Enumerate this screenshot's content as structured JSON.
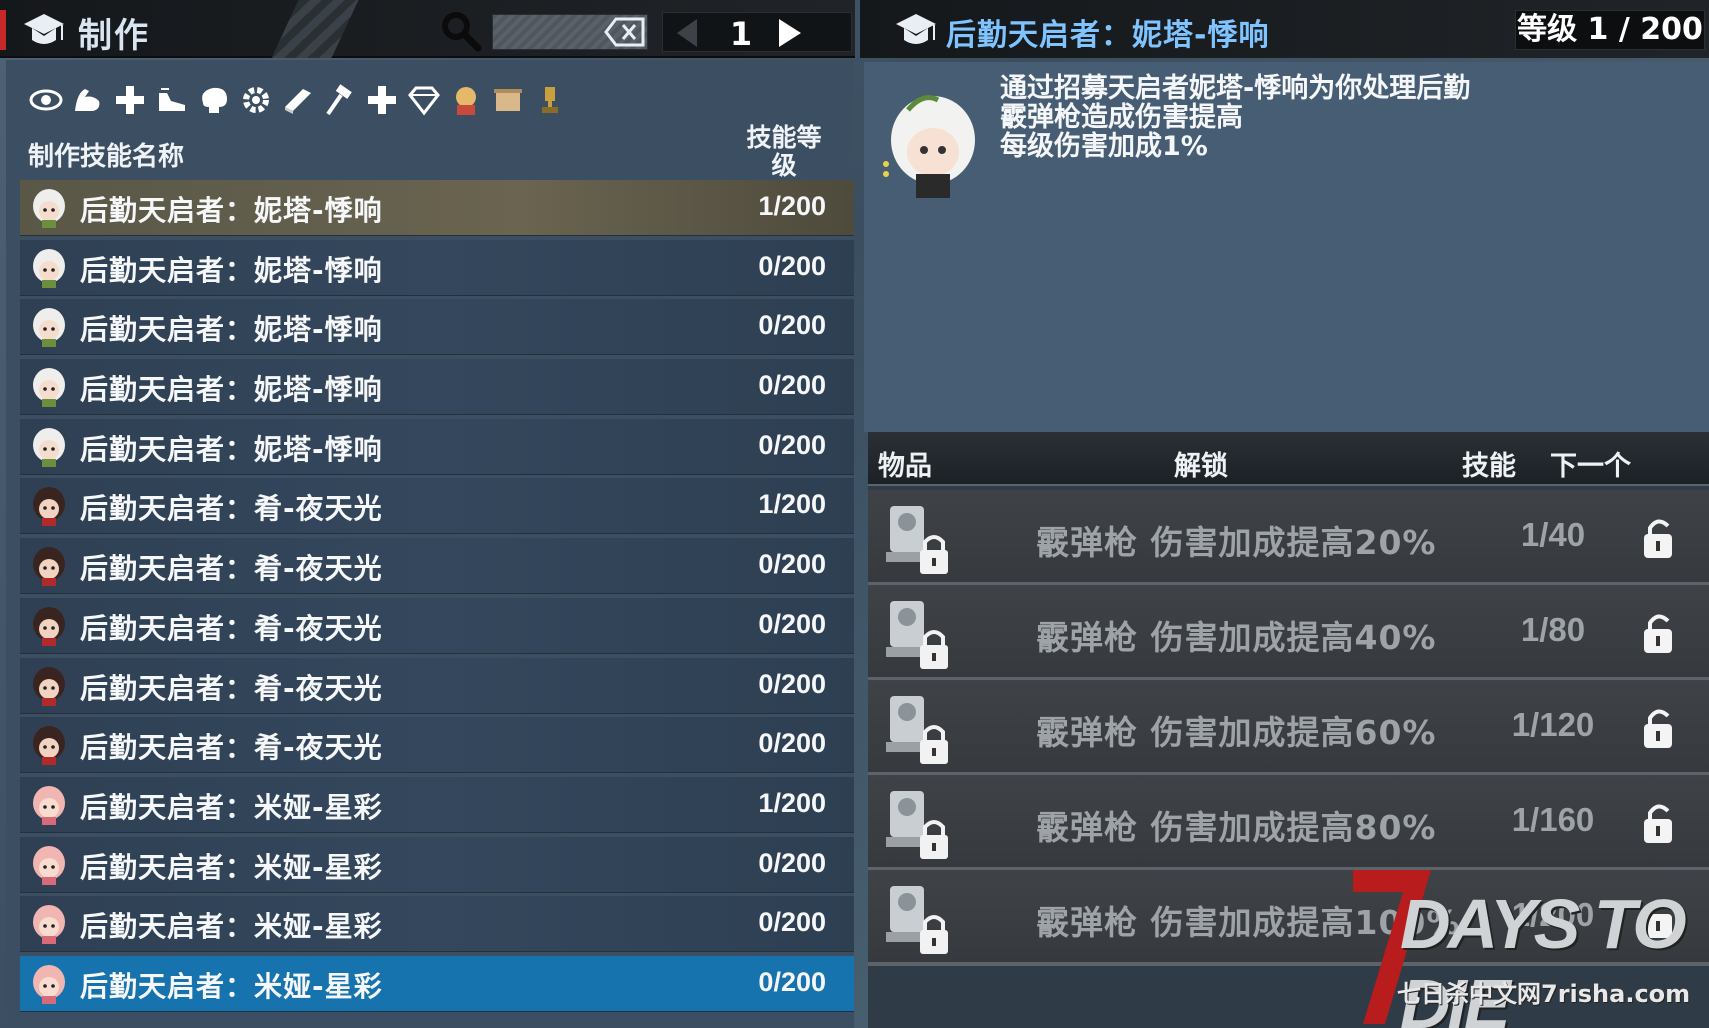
{
  "left": {
    "title": "制作",
    "page": "1",
    "col_name": "制作技能名称",
    "col_level": "技能等级",
    "filters": [
      "eye-icon",
      "muscle-icon",
      "plus-icon",
      "shoe-icon",
      "brain-icon",
      "gear-icon",
      "book-icon",
      "hammer-icon",
      "plus-icon",
      "diamond-icon",
      "character-icon",
      "scroll-icon",
      "trophy-icon"
    ],
    "rows": [
      {
        "name": "后勤天启者：妮塔-悸响",
        "level": "1/200",
        "state": "highlight",
        "avatar": "white"
      },
      {
        "name": "后勤天启者：妮塔-悸响",
        "level": "0/200",
        "state": "",
        "avatar": "white"
      },
      {
        "name": "后勤天启者：妮塔-悸响",
        "level": "0/200",
        "state": "",
        "avatar": "white"
      },
      {
        "name": "后勤天启者：妮塔-悸响",
        "level": "0/200",
        "state": "",
        "avatar": "white"
      },
      {
        "name": "后勤天启者：妮塔-悸响",
        "level": "0/200",
        "state": "",
        "avatar": "white"
      },
      {
        "name": "后勤天启者：肴-夜天光",
        "level": "1/200",
        "state": "",
        "avatar": "dark"
      },
      {
        "name": "后勤天启者：肴-夜天光",
        "level": "0/200",
        "state": "",
        "avatar": "dark"
      },
      {
        "name": "后勤天启者：肴-夜天光",
        "level": "0/200",
        "state": "",
        "avatar": "dark"
      },
      {
        "name": "后勤天启者：肴-夜天光",
        "level": "0/200",
        "state": "",
        "avatar": "dark"
      },
      {
        "name": "后勤天启者：肴-夜天光",
        "level": "0/200",
        "state": "",
        "avatar": "dark"
      },
      {
        "name": "后勤天启者：米娅-星彩",
        "level": "1/200",
        "state": "",
        "avatar": "pink"
      },
      {
        "name": "后勤天启者：米娅-星彩",
        "level": "0/200",
        "state": "",
        "avatar": "pink"
      },
      {
        "name": "后勤天启者：米娅-星彩",
        "level": "0/200",
        "state": "",
        "avatar": "pink"
      },
      {
        "name": "后勤天启者：米娅-星彩",
        "level": "0/200",
        "state": "selected",
        "avatar": "pink"
      }
    ]
  },
  "right": {
    "title": "后勤天启者：妮塔-悸响",
    "level": "等级 1 / 200",
    "description": [
      "通过招募天启者妮塔-悸响为你处理后勤",
      "霰弹枪造成伤害提高",
      "每级伤害加成1%"
    ],
    "table_head": {
      "item": "物品",
      "unlock": "解锁",
      "skill": "技能",
      "next": "下一个"
    },
    "unlocks": [
      {
        "text": "霰弹枪 伤害加成提高20%",
        "skill": "1/40"
      },
      {
        "text": "霰弹枪 伤害加成提高40%",
        "skill": "1/80"
      },
      {
        "text": "霰弹枪 伤害加成提高60%",
        "skill": "1/120"
      },
      {
        "text": "霰弹枪 伤害加成提高80%",
        "skill": "1/160"
      },
      {
        "text": "霰弹枪 伤害加成提高100%",
        "skill": "1/200"
      }
    ]
  },
  "watermark": {
    "main": "DAYS TO DIE",
    "sub": "七日杀中文网7risha.com"
  }
}
